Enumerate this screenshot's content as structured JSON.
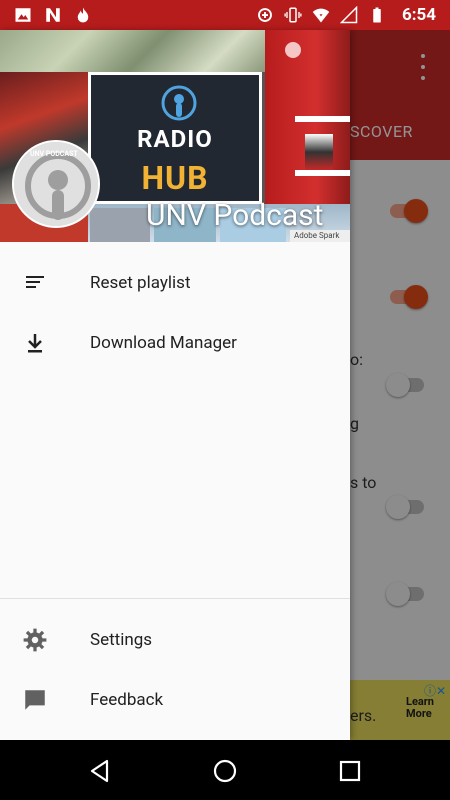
{
  "status_bar": {
    "time": "6:54",
    "left_icons": [
      "image-icon",
      "n-news-icon",
      "flame-icon"
    ],
    "right_icons": [
      "data-saver-icon",
      "vibrate-icon",
      "wifi-icon",
      "signal-icon",
      "battery-icon"
    ]
  },
  "background_app": {
    "tab_label": "SCOVER",
    "settings_fragments": [
      "o:",
      "g",
      "s to"
    ],
    "ad": {
      "text": "ers.",
      "cta": "Learn More"
    },
    "colors": {
      "appbar": "#c62828",
      "accent": "#e64a19"
    }
  },
  "drawer": {
    "header": {
      "avatar_label": "UNV PODCAST",
      "title": "UNV Podcast",
      "radio_hub_line1": "RADIO",
      "radio_hub_line2": "HUB",
      "credit": "Adobe Spark"
    },
    "items": [
      {
        "label": "Reset playlist",
        "icon": "playlist-icon"
      },
      {
        "label": "Download Manager",
        "icon": "download-icon"
      }
    ],
    "footer_items": [
      {
        "label": "Settings",
        "icon": "gear-icon"
      },
      {
        "label": "Feedback",
        "icon": "feedback-icon"
      }
    ]
  },
  "nav_bar": {
    "buttons": [
      "back-icon",
      "home-icon",
      "recents-icon"
    ]
  }
}
